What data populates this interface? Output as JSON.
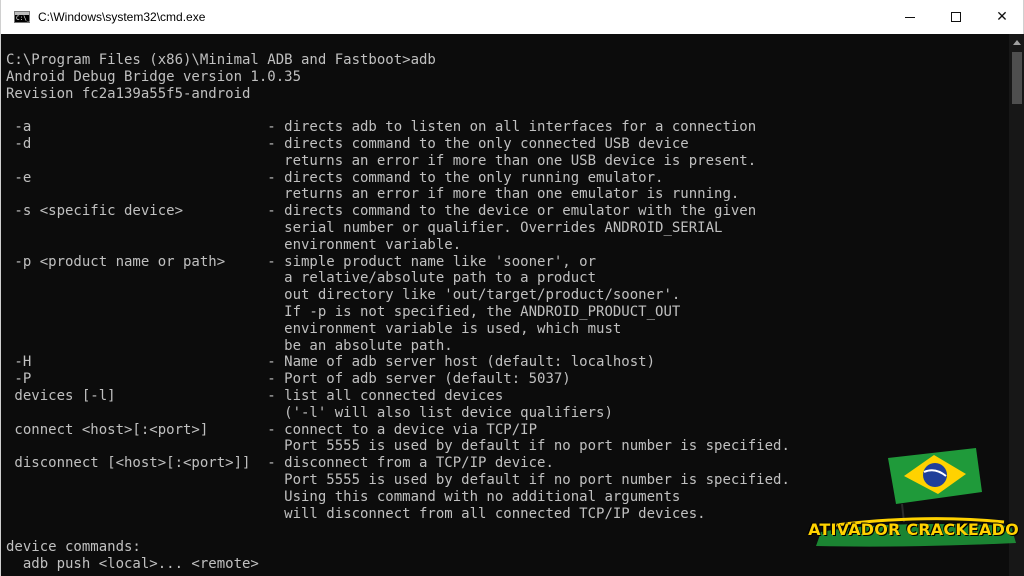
{
  "window": {
    "title": "C:\\Windows\\system32\\cmd.exe",
    "icon": "cmd-icon",
    "icon_glyph": "C:\\_"
  },
  "controls": {
    "minimize": "minimize-icon",
    "maximize": "maximize-icon",
    "close": "close-icon",
    "close_glyph": "✕"
  },
  "console": {
    "colors": {
      "background": "#0c0c0c",
      "text": "#c0c0c0"
    },
    "lines": [
      "C:\\Program Files (x86)\\Minimal ADB and Fastboot>adb",
      "Android Debug Bridge version 1.0.35",
      "Revision fc2a139a55f5-android",
      "",
      " -a                            - directs adb to listen on all interfaces for a connection",
      " -d                            - directs command to the only connected USB device",
      "                                 returns an error if more than one USB device is present.",
      " -e                            - directs command to the only running emulator.",
      "                                 returns an error if more than one emulator is running.",
      " -s <specific device>          - directs command to the device or emulator with the given",
      "                                 serial number or qualifier. Overrides ANDROID_SERIAL",
      "                                 environment variable.",
      " -p <product name or path>     - simple product name like 'sooner', or",
      "                                 a relative/absolute path to a product",
      "                                 out directory like 'out/target/product/sooner'.",
      "                                 If -p is not specified, the ANDROID_PRODUCT_OUT",
      "                                 environment variable is used, which must",
      "                                 be an absolute path.",
      " -H                            - Name of adb server host (default: localhost)",
      " -P                            - Port of adb server (default: 5037)",
      " devices [-l]                  - list all connected devices",
      "                                 ('-l' will also list device qualifiers)",
      " connect <host>[:<port>]       - connect to a device via TCP/IP",
      "                                 Port 5555 is used by default if no port number is specified.",
      " disconnect [<host>[:<port>]]  - disconnect from a TCP/IP device.",
      "                                 Port 5555 is used by default if no port number is specified.",
      "                                 Using this command with no additional arguments",
      "                                 will disconnect from all connected TCP/IP devices.",
      "",
      "device commands:",
      "  adb push <local>... <remote>"
    ]
  },
  "scrollbar": {
    "up_icon": "scroll-up-arrow-icon"
  },
  "watermark": {
    "text": "ATIVADOR CRACKEADO",
    "flag_icon": "brazil-flag-icon",
    "colors": {
      "green": "#1f9a3a",
      "yellow": "#ffd200",
      "blue": "#1f3f9a",
      "white": "#ffffff"
    }
  }
}
